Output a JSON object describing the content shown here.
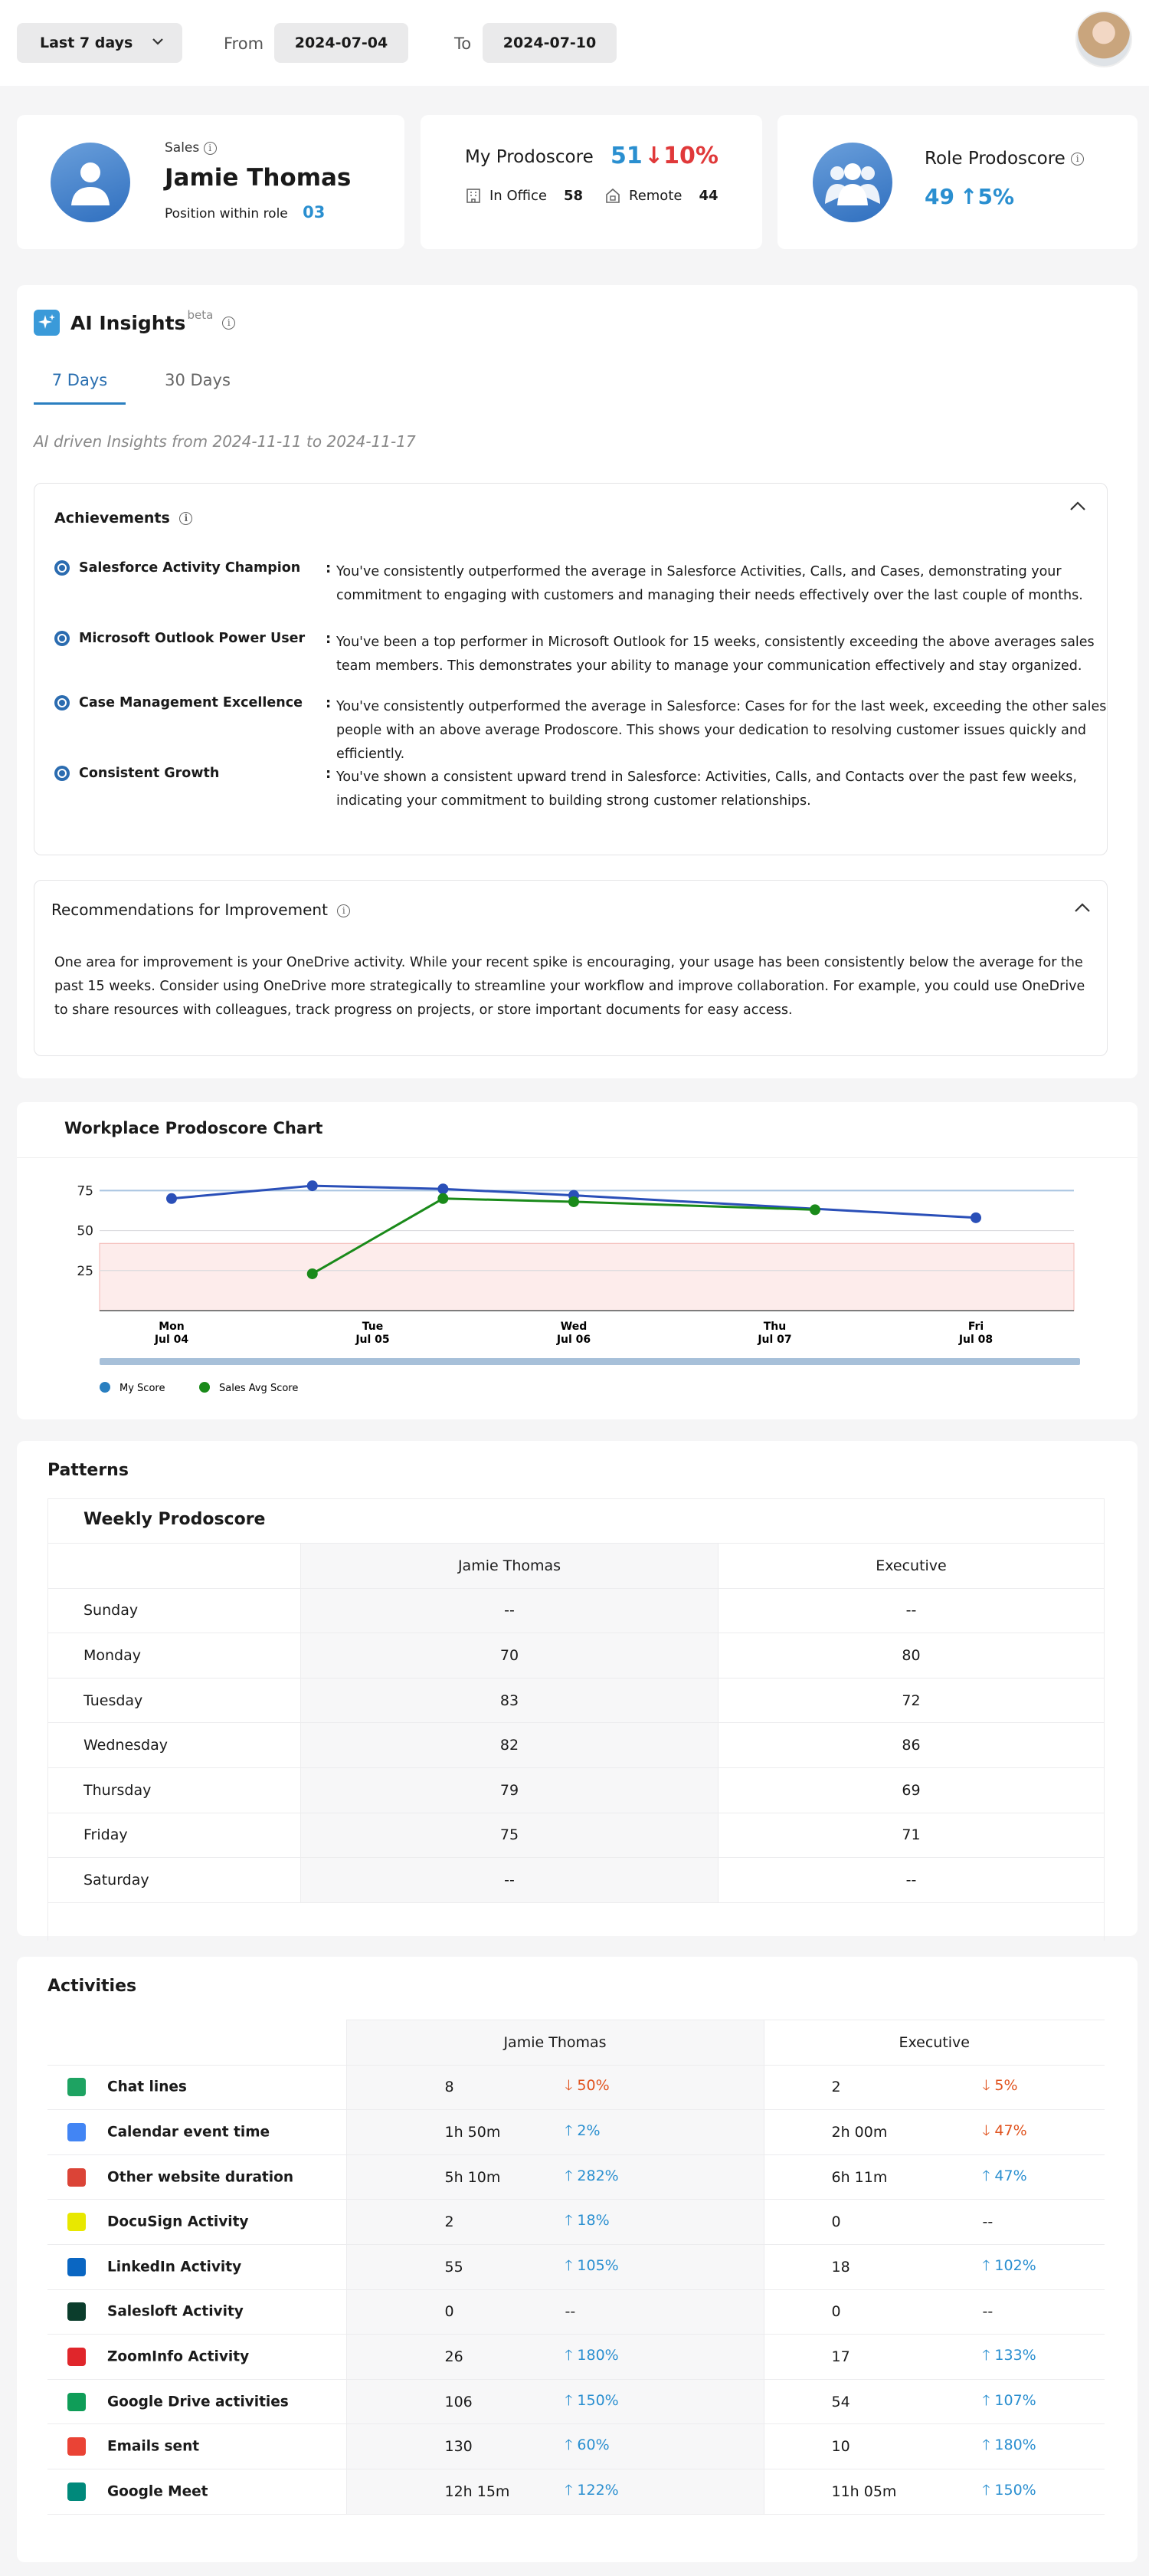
{
  "toolbar": {
    "range_label": "Last 7 days",
    "from_label": "From",
    "from_value": "2024-07-04",
    "to_label": "To",
    "to_value": "2024-07-10"
  },
  "profile": {
    "role": "Sales",
    "name": "Jamie Thomas",
    "position_label": "Position within role",
    "position_value": "03"
  },
  "my_prodoscore": {
    "label": "My Prodoscore",
    "value": "51",
    "change": "↓10%",
    "in_office_label": "In Office",
    "in_office_value": "58",
    "remote_label": "Remote",
    "remote_value": "44"
  },
  "role_prodoscore": {
    "label": "Role Prodoscore",
    "value": "49",
    "change": "↑5%"
  },
  "insights": {
    "title": "AI Insights",
    "beta": "beta",
    "tabs": [
      "7 Days",
      "30 Days"
    ],
    "subtitle": "AI driven Insights from 2024-11-11 to 2024-11-17",
    "achievements_title": "Achievements",
    "achievements": [
      {
        "title": "Salesforce Activity Champion",
        "text": "You've consistently outperformed the average in Salesforce Activities, Calls, and Cases, demonstrating your commitment to engaging with customers and managing their needs effectively over the last couple of months."
      },
      {
        "title": "Microsoft Outlook Power User",
        "text": "You've been a top performer in Microsoft Outlook for 15 weeks, consistently exceeding the above averages sales team members. This demonstrates your ability to manage your communication effectively and stay organized."
      },
      {
        "title": "Case Management Excellence",
        "text": "You've consistently outperformed the average in Salesforce: Cases for for the last week, exceeding the other sales people with an above average Prodoscore. This shows your dedication to resolving customer issues quickly and efficiently."
      },
      {
        "title": "Consistent Growth",
        "text": "You've shown a consistent upward trend in Salesforce: Activities, Calls, and Contacts over the past few weeks, indicating your commitment to building strong customer relationships."
      }
    ],
    "recommendations_title": "Recommendations for Improvement",
    "recommendations_text": "One area for improvement is your OneDrive activity. While your recent spike is encouraging, your usage has been consistently below the average for the past 15 weeks. Consider using OneDrive more strategically to streamline your workflow and improve collaboration. For example, you could use OneDrive to share resources with colleagues, track progress on projects, or store important documents for easy access."
  },
  "chart_data": {
    "type": "line",
    "title": "Workplace Prodoscore Chart",
    "x": [
      "Mon|Jul 04",
      "Tue|Jul 05",
      "Wed|Jul 06",
      "Thu|Jul 07",
      "Fri|Jul 08"
    ],
    "y_ticks": [
      "75",
      "50",
      "25"
    ],
    "ylim": [
      0,
      90
    ],
    "series": [
      {
        "name": "My Score",
        "color": "#2a4fb8",
        "points": [
          [
            0,
            70
          ],
          [
            0.7,
            78
          ],
          [
            1.35,
            76
          ],
          [
            2,
            72
          ],
          [
            4,
            58
          ]
        ]
      },
      {
        "name": "Sales Avg Score",
        "color": "#1a8a1a",
        "points": [
          [
            0.7,
            23
          ],
          [
            1.35,
            70
          ],
          [
            2,
            68
          ],
          [
            3.2,
            63
          ]
        ]
      }
    ],
    "band": [
      0,
      42
    ],
    "legend_position": "bottom-left"
  },
  "patterns": {
    "title": "Patterns",
    "subtitle": "Weekly Prodoscore",
    "col1": "Jamie Thomas",
    "col2": "Executive",
    "rows": [
      {
        "day": "Sunday",
        "a": "--",
        "b": "--"
      },
      {
        "day": "Monday",
        "a": "70",
        "b": "80"
      },
      {
        "day": "Tuesday",
        "a": "83",
        "b": "72"
      },
      {
        "day": "Wednesday",
        "a": "82",
        "b": "86"
      },
      {
        "day": "Thursday",
        "a": "79",
        "b": "69"
      },
      {
        "day": "Friday",
        "a": "75",
        "b": "71"
      },
      {
        "day": "Saturday",
        "a": "--",
        "b": "--"
      }
    ]
  },
  "activities": {
    "title": "Activities",
    "col1": "Jamie Thomas",
    "col2": "Executive",
    "rows": [
      {
        "name": "Chat lines",
        "icon": "google-chat-icon",
        "color": "#1ea362",
        "a": "8",
        "ac": "50%",
        "ad": "down",
        "b": "2",
        "bc": "5%",
        "bd": "down"
      },
      {
        "name": "Calendar event time",
        "icon": "google-calendar-icon",
        "color": "#4285f4",
        "a": "1h 50m",
        "ac": "2%",
        "ad": "up",
        "b": "2h 00m",
        "bc": "47%",
        "bd": "down"
      },
      {
        "name": "Other website duration",
        "icon": "chrome-icon",
        "color": "#db4437",
        "a": "5h 10m",
        "ac": "282%",
        "ad": "up",
        "b": "6h 11m",
        "bc": "47%",
        "bd": "up"
      },
      {
        "name": "DocuSign Activity",
        "icon": "docusign-icon",
        "color": "#e8e800",
        "a": "2",
        "ac": "18%",
        "ad": "up",
        "b": "0",
        "bc": "--",
        "bd": "flat"
      },
      {
        "name": "LinkedIn Activity",
        "icon": "linkedin-icon",
        "color": "#0a66c2",
        "a": "55",
        "ac": "105%",
        "ad": "up",
        "b": "18",
        "bc": "102%",
        "bd": "up"
      },
      {
        "name": "Salesloft Activity",
        "icon": "salesloft-icon",
        "color": "#0b3d2c",
        "a": "0",
        "ac": "--",
        "ad": "flat",
        "b": "0",
        "bc": "--",
        "bd": "flat"
      },
      {
        "name": "ZoomInfo Activity",
        "icon": "zoominfo-icon",
        "color": "#e0262b",
        "a": "26",
        "ac": "180%",
        "ad": "up",
        "b": "17",
        "bc": "133%",
        "bd": "up"
      },
      {
        "name": "Google Drive activities",
        "icon": "google-drive-icon",
        "color": "#0f9d58",
        "a": "106",
        "ac": "150%",
        "ad": "up",
        "b": "54",
        "bc": "107%",
        "bd": "up"
      },
      {
        "name": "Emails sent",
        "icon": "gmail-icon",
        "color": "#ea4335",
        "a": "130",
        "ac": "60%",
        "ad": "up",
        "b": "10",
        "bc": "180%",
        "bd": "up"
      },
      {
        "name": "Google Meet",
        "icon": "google-meet-icon",
        "color": "#00897b",
        "a": "12h 15m",
        "ac": "122%",
        "ad": "up",
        "b": "11h 05m",
        "bc": "150%",
        "bd": "up"
      }
    ]
  }
}
